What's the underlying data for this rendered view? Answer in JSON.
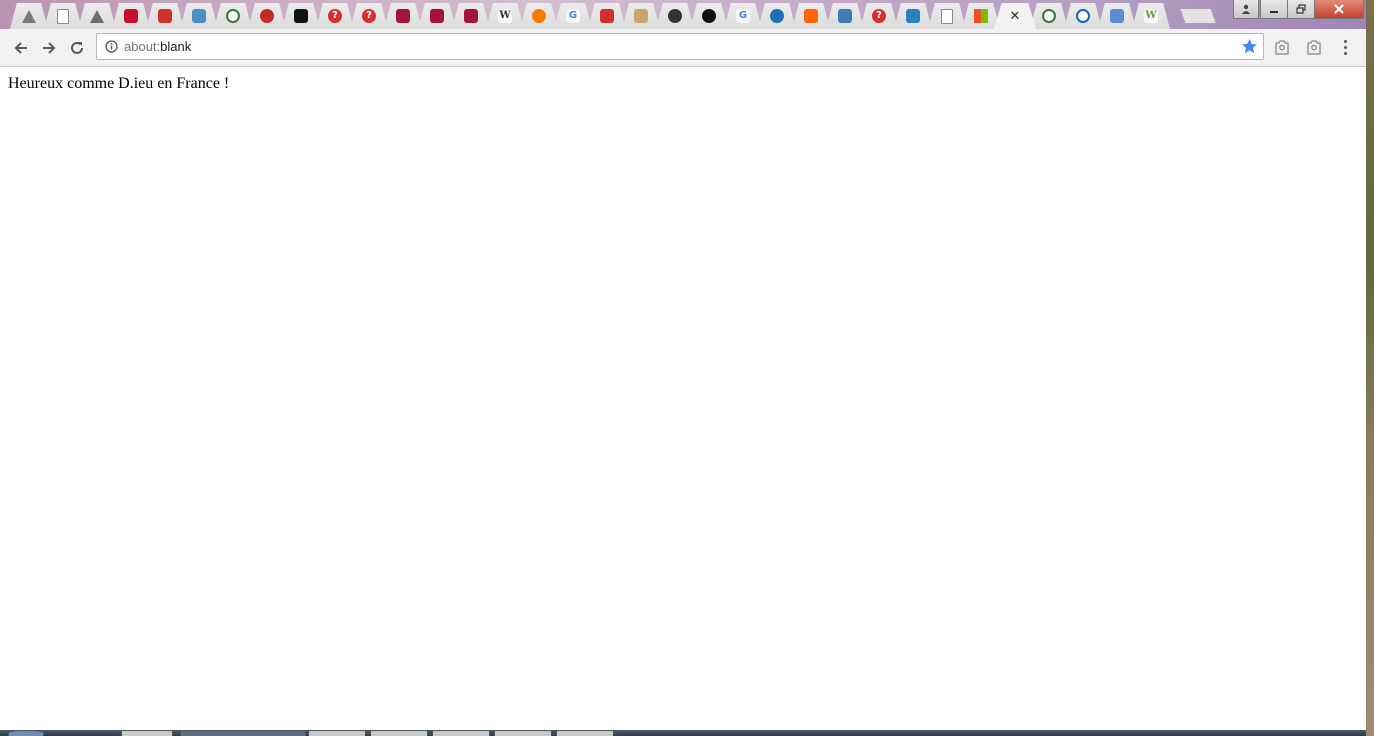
{
  "browser": {
    "tabs": [
      {
        "icon": "triangle-logo-icon",
        "color": "#7a7a7a"
      },
      {
        "icon": "blank-page-icon",
        "color": "#8a8a8a"
      },
      {
        "icon": "triangle-logo-icon",
        "color": "#6b6b6b"
      },
      {
        "icon": "red-swoosh-icon",
        "color": "#c8102e"
      },
      {
        "icon": "slash-logo-icon",
        "color": "#d0312d"
      },
      {
        "icon": "blue-v-icon",
        "color": "#4a90c2"
      },
      {
        "icon": "code-brackets-icon",
        "color": "#2e7d32"
      },
      {
        "icon": "red-ring-icon",
        "color": "#c62828"
      },
      {
        "icon": "m-logo-icon",
        "color": "#111111"
      },
      {
        "icon": "question-icon",
        "color": "#d32f2f"
      },
      {
        "icon": "question-icon",
        "color": "#d32f2f"
      },
      {
        "icon": "red-shape-icon",
        "color": "#a4133c"
      },
      {
        "icon": "red-shape-icon",
        "color": "#a4133c"
      },
      {
        "icon": "red-shape-icon",
        "color": "#a4133c"
      },
      {
        "icon": "wikipedia-icon",
        "color": "#333333",
        "letter": "W"
      },
      {
        "icon": "orange-swirl-icon",
        "color": "#f57c00"
      },
      {
        "icon": "google-icon",
        "color": "#4285f4",
        "letter": "G"
      },
      {
        "icon": "slash-logo-icon",
        "color": "#d0312d"
      },
      {
        "icon": "flower-icon",
        "color": "#c9a66b"
      },
      {
        "icon": "face-icon",
        "color": "#333333"
      },
      {
        "icon": "github-icon",
        "color": "#111111"
      },
      {
        "icon": "google-icon",
        "color": "#4285f4",
        "letter": "G"
      },
      {
        "icon": "drop-icon",
        "color": "#1e6fb8"
      },
      {
        "icon": "orange-square-icon",
        "color": "#ff6600"
      },
      {
        "icon": "pattern-icon",
        "color": "#3d7fb5"
      },
      {
        "icon": "question-icon",
        "color": "#d32f2f"
      },
      {
        "icon": "blue-drop-square-icon",
        "color": "#2a7fc1"
      },
      {
        "icon": "blank-page-icon",
        "color": "#8a8a8a"
      },
      {
        "icon": "microsoft-icon",
        "color": "#f25022"
      },
      {
        "icon": "active-tab-close-icon",
        "color": "#333333",
        "active": true
      },
      {
        "icon": "code-brackets-icon",
        "color": "#2e7d32"
      },
      {
        "icon": "code-brackets-icon",
        "color": "#1565c0"
      },
      {
        "icon": "shield-icon",
        "color": "#5b8bd0"
      },
      {
        "icon": "wh-logo-icon",
        "color": "#6a9a3a",
        "letter": "W"
      }
    ],
    "omnibox": {
      "scheme": "about:",
      "path": "blank"
    },
    "accent_color": "#4285f4"
  },
  "page": {
    "text": "Heureux comme D.ieu en France !"
  }
}
